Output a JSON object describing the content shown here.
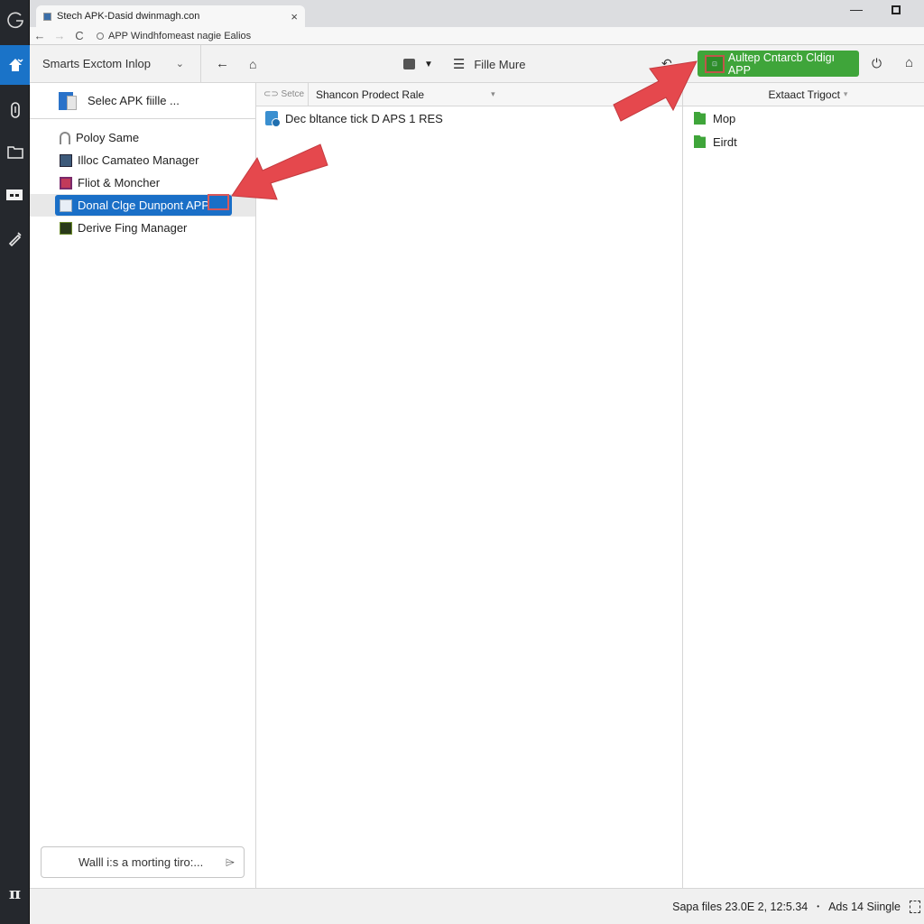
{
  "browser": {
    "tab_title": "Stech APK-Dasid dwinmagh.con",
    "tab_close": "×",
    "url": "APP Windhfomeast nagie Ealios",
    "window_minimize": "—"
  },
  "rail": {
    "items": [
      {
        "icon": "logo-g-icon",
        "glyph": "G"
      },
      {
        "icon": "home-upload-icon",
        "glyph": "⇧",
        "active": true
      },
      {
        "icon": "paperclip-icon",
        "glyph": "0"
      },
      {
        "icon": "folder-icon",
        "glyph": "▭"
      },
      {
        "icon": "mask-icon",
        "glyph": "▬"
      },
      {
        "icon": "pen-icon",
        "glyph": "✎"
      }
    ],
    "bottom_glyph": "π"
  },
  "toolbar": {
    "app_select": "Smarts Exctom Inlop",
    "back_glyph": "←",
    "home_glyph": "⌂",
    "menu_glyph": "☰",
    "file_more": "Fille Mure",
    "undo_glyph": "↶",
    "extract_button": "Aultep Cntarcb Cldigı APP",
    "extract_button_mini": "⊡",
    "power_glyph": "⏻",
    "house_glyph": "⌂"
  },
  "left_pane": {
    "select_apk": "Selec APK fiille ...",
    "tree": [
      {
        "label": "Poloy Same",
        "icon": "policy-icon",
        "selected": false
      },
      {
        "label": "Illoc Camateo Manager",
        "icon": "camera-manager-icon",
        "selected": false
      },
      {
        "label": "Fliot & Moncher",
        "icon": "launcher-icon",
        "selected": false
      },
      {
        "label": "Donal Clge Dunpont APP",
        "icon": "folder-icon",
        "selected": true
      },
      {
        "label": "Derive Fing Manager",
        "icon": "drive-manager-icon",
        "selected": false
      }
    ],
    "search_value": "Walll i:s a morting tiro:...",
    "search_icon_glyph": "⌲"
  },
  "mid_pane": {
    "col_setce": "⊂⊃ Setce",
    "col_name": "Shancon Prodect Rale",
    "files": [
      {
        "name": "Dec bltance tick D APS 1 RES"
      }
    ]
  },
  "right_pane": {
    "header": "Extaact Trigoct",
    "folders": [
      {
        "name": "Mop"
      },
      {
        "name": "Eirdt"
      }
    ]
  },
  "statusbar": {
    "saved": "Sapa files 23.0E 2, 12:5.34",
    "separator": "•",
    "ads": "Ads 14 Siingle"
  },
  "colors": {
    "accent_blue": "#1a6fc7",
    "extract_green": "#3fa53a",
    "annotation_red": "#e5484d",
    "rail_dark": "#25282d"
  }
}
